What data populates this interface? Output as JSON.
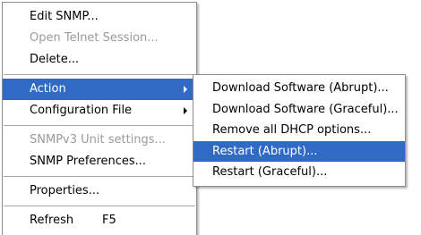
{
  "main_menu": {
    "edit_snmp": "Edit SNMP...",
    "open_telnet": "Open Telnet Session...",
    "delete": "Delete...",
    "action": "Action",
    "configuration_file": "Configuration File",
    "snmpv3_unit_settings": "SNMPv3 Unit settings...",
    "snmp_preferences": "SNMP Preferences...",
    "properties": "Properties...",
    "refresh": "Refresh",
    "refresh_shortcut": "F5"
  },
  "action_submenu": {
    "download_abrupt": "Download Software (Abrupt)...",
    "download_graceful": "Download Software (Graceful)...",
    "remove_dhcp": "Remove all DHCP options...",
    "restart_abrupt": "Restart (Abrupt)...",
    "restart_graceful": "Restart (Graceful)..."
  },
  "colors": {
    "highlight": "#316ac5",
    "disabled_text": "#9a9a9a"
  },
  "icons": {
    "submenu_arrow": "submenu-arrow-icon"
  }
}
